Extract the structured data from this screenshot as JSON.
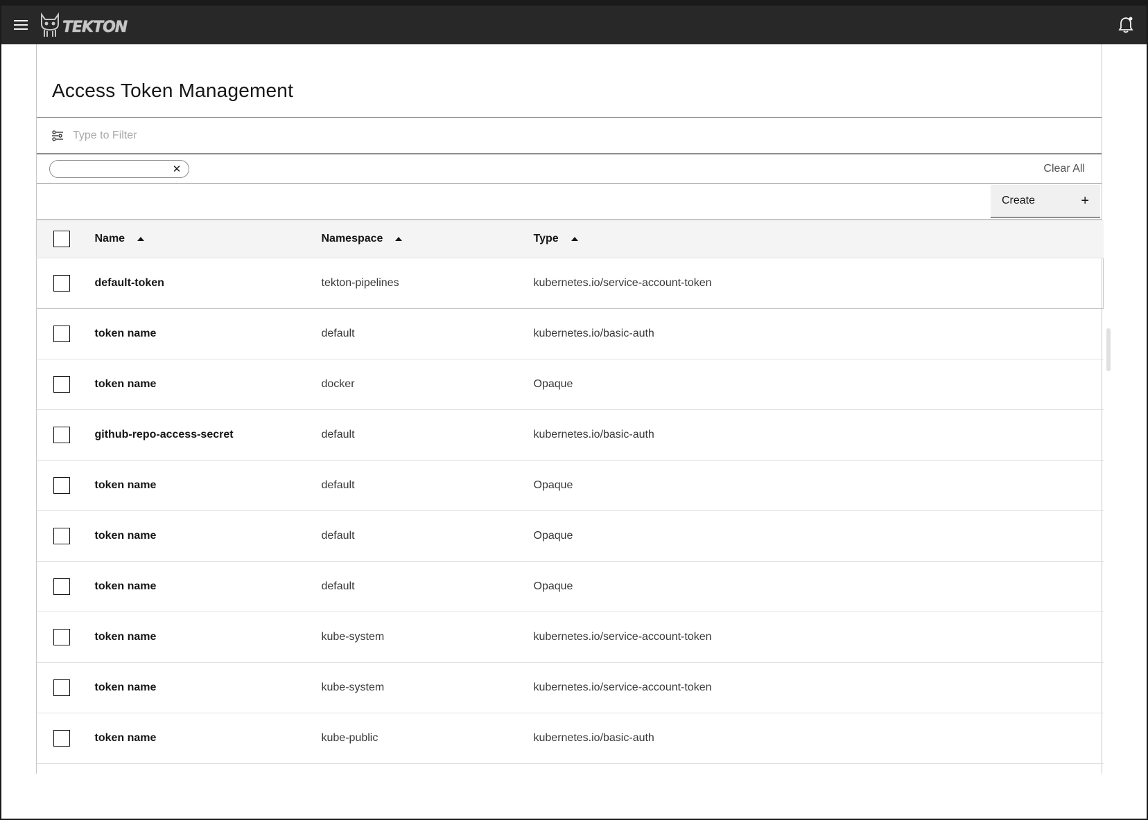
{
  "app": {
    "logo_text": "TEKTON"
  },
  "page": {
    "title": "Access Token Management"
  },
  "filter": {
    "placeholder": "Type to Filter",
    "value": ""
  },
  "filter_tags": {
    "tag_value": "",
    "clear_all_label": "Clear All"
  },
  "toolbar": {
    "create_label": "Create",
    "create_icon": "plus-icon"
  },
  "table": {
    "columns": [
      {
        "label": "Name",
        "sort": "ascending"
      },
      {
        "label": "Namespace",
        "sort": "ascending"
      },
      {
        "label": "Type",
        "sort": "ascending"
      }
    ],
    "rows": [
      {
        "name": "default-token",
        "namespace": "tekton-pipelines",
        "type": "kubernetes.io/service-account-token"
      },
      {
        "name": "token name",
        "namespace": "default",
        "type": "kubernetes.io/basic-auth"
      },
      {
        "name": "token name",
        "namespace": "docker",
        "type": "Opaque"
      },
      {
        "name": "github-repo-access-secret",
        "namespace": "default",
        "type": "kubernetes.io/basic-auth"
      },
      {
        "name": "token name",
        "namespace": "default",
        "type": "Opaque"
      },
      {
        "name": "token name",
        "namespace": "default",
        "type": "Opaque"
      },
      {
        "name": "token name",
        "namespace": "default",
        "type": "Opaque"
      },
      {
        "name": "token name",
        "namespace": "kube-system",
        "type": "kubernetes.io/service-account-token"
      },
      {
        "name": "token name",
        "namespace": "kube-system",
        "type": "kubernetes.io/service-account-token"
      },
      {
        "name": "token name",
        "namespace": "kube-public",
        "type": "kubernetes.io/basic-auth"
      }
    ]
  },
  "colors": {
    "header_bg": "#282828",
    "table_header_bg": "#f4f4f4",
    "button_bg": "#f0f0f0"
  },
  "icons": [
    "hamburger-menu-icon",
    "tekton-cat-logo-icon",
    "notification-bell-icon",
    "filter-settings-icon",
    "close-icon",
    "plus-icon",
    "sort-ascending-icon"
  ]
}
